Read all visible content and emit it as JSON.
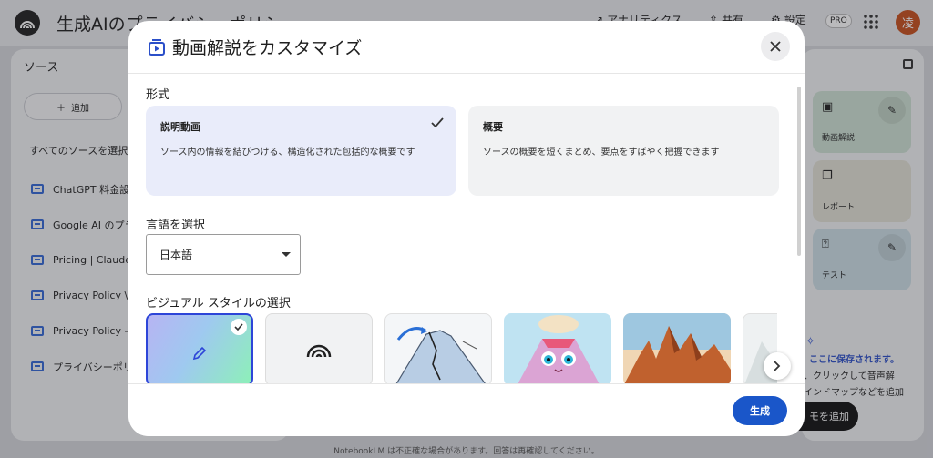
{
  "app": {
    "title": "生成AIのプライバシーポリシー",
    "header_buttons": [
      {
        "label": "アナリティクス",
        "icon": "analytics-icon"
      },
      {
        "label": "共有",
        "icon": "share-icon"
      },
      {
        "label": "設定",
        "icon": "gear-icon"
      }
    ],
    "pro_badge": "PRO",
    "avatar_initial": "凌"
  },
  "sources_panel": {
    "title": "ソース",
    "add_label": "追加",
    "select_all_label": "すべてのソースを選択",
    "items": [
      {
        "label": "ChatGPT 料金設"
      },
      {
        "label": "Google AI のプラ"
      },
      {
        "label": "Pricing | Claude"
      },
      {
        "label": "Privacy Policy \\ A"
      },
      {
        "label": "Privacy Policy – "
      },
      {
        "label": "プライバシーポリ"
      }
    ]
  },
  "studio_panel": {
    "cards": [
      {
        "label": "動画解説",
        "icon": "video-overview-icon"
      },
      {
        "label": "レポート",
        "icon": "report-icon"
      },
      {
        "label": "テスト",
        "icon": "quiz-icon"
      }
    ],
    "save_hint_title": "ここに保存されます。",
    "save_hint_line1": "、クリックして音声解",
    "save_hint_line2": "インドマップなどを追加",
    "add_note_label": "モを追加"
  },
  "footer_note": "NotebookLM は不正確な場合があります。回答は再確認してください。",
  "modal": {
    "title": "動画解説をカスタマイズ",
    "format_label": "形式",
    "formats": [
      {
        "title": "説明動画",
        "description": "ソース内の情報を結びつける、構造化された包括的な概要です",
        "selected": true
      },
      {
        "title": "概要",
        "description": "ソースの概要を短くまとめ、要点をすばやく把握できます",
        "selected": false
      }
    ],
    "language_label": "言語を選択",
    "language_value": "日本語",
    "visual_style_label": "ビジュアル スタイルの選択",
    "generate_label": "生成"
  },
  "colors": {
    "accent": "#1a56c9",
    "selected_card": "#e9ecfa",
    "selected_border": "#2d45d8"
  }
}
